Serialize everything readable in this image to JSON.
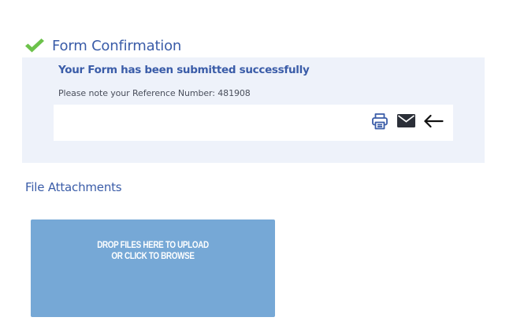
{
  "header": {
    "title": "Form Confirmation",
    "icon": "check-icon",
    "icon_color": "#6cc24a"
  },
  "confirmation": {
    "message": "Your Form has been submitted successfully",
    "reference_text": "Please note your Reference Number: 481908",
    "actions": [
      {
        "icon": "print-icon",
        "label": "Print"
      },
      {
        "icon": "email-icon",
        "label": "Email"
      },
      {
        "icon": "back-arrow-icon",
        "label": "Back"
      }
    ]
  },
  "attachments": {
    "title": "File Attachments",
    "dropzone_line1": "DROP FILES HERE TO UPLOAD",
    "dropzone_line2": "OR CLICK TO BROWSE"
  },
  "colors": {
    "accent": "#3a5ca8",
    "panel_bg": "#eef2fa",
    "dropzone_bg": "#76a8d6"
  }
}
